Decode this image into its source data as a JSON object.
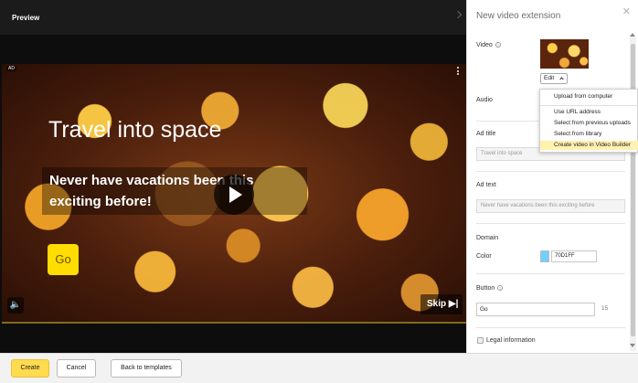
{
  "preview": {
    "title": "Preview",
    "ad_tag": "AD",
    "headline": "Travel into space",
    "body": "Never have vacations been this exciting before!",
    "button": "Go",
    "skip": "Skip ▶|",
    "volume": "🔈"
  },
  "panel": {
    "title": "New video extension",
    "close": "✕",
    "video_label": "Video",
    "edit_label": "Edit",
    "audio_label": "Audio",
    "ad_title_label": "Ad title",
    "ad_title_placeholder": "Travel into space",
    "ad_text_label": "Ad text",
    "ad_text_placeholder": "Never have vacations been this exciting before",
    "domain_label": "Domain",
    "color_label": "Color",
    "color_value": "70D1FF",
    "button_label": "Button",
    "button_value": "Go",
    "button_count": "15",
    "legal_label": "Legal information"
  },
  "menu": {
    "items": [
      "Upload from computer",
      "Use URL address",
      "Select from previous uploads",
      "Select from library",
      "Create video in Video Builder"
    ]
  },
  "footer": {
    "create": "Create",
    "cancel": "Cancel",
    "back": "Back to templates"
  },
  "colors": {
    "accent": "#ffdb4d",
    "swatch": "#70d1ff"
  }
}
